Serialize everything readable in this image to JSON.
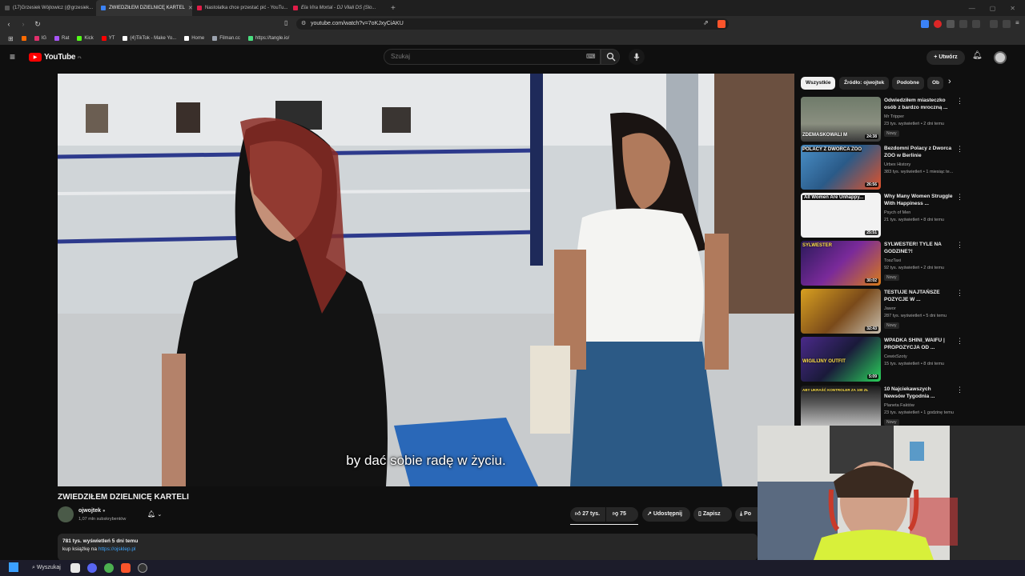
{
  "browser": {
    "tabs": [
      {
        "label": "(17)Grzesiek Wójtowicz (@grzesiek...",
        "favicon_color": "#555"
      },
      {
        "label": "ZWIEDZIŁEM DZIELNICĘ KARTEL",
        "favicon_color": "#3b82f6",
        "active": true
      },
      {
        "label": "Nastolatka chce przestać pić - YouTu...",
        "favicon_color": "#e11d48"
      },
      {
        "label": "Ela Vira Mortal - DJ Vilali DS (Slo...",
        "favicon_color": "#e11d48"
      }
    ],
    "url": "youtube.com/watch?v=7oKJxyCiAKU",
    "bookmarks": [
      {
        "label": "IG",
        "color": "#e1306c"
      },
      {
        "label": "Rat",
        "color": "#a855f7"
      },
      {
        "label": "Kick",
        "color": "#53fc18"
      },
      {
        "label": "YT",
        "color": "#ff0000"
      },
      {
        "label": "(4)TikTok - Make Yo...",
        "color": "#ffffff"
      },
      {
        "label": "Home",
        "color": "#ffffff"
      },
      {
        "label": "Filman.cc",
        "color": "#9ca3af"
      },
      {
        "label": "https://tangle.io/",
        "color": "#4ade80"
      }
    ]
  },
  "youtube": {
    "logo_text": "YouTube",
    "logo_country": "PL",
    "search_placeholder": "Szukaj",
    "create_label": "Utwórz",
    "video": {
      "caption": "by dać sobie radę w życiu.",
      "title": "ZWIEDZIŁEM DZIELNICĘ KARTELI",
      "channel": "ojwojtek",
      "subscribers": "1,07 mln subskrybentów",
      "likes": "27 tys.",
      "dislikes": "75",
      "share_label": "Udostępnij",
      "save_label": "Zapisz",
      "download_label": "Po"
    },
    "description": {
      "meta": "781 tys. wyświetleń  5 dni temu",
      "line1_prefix": "kup książkę na ",
      "line1_link": "https://ojsklep.pl"
    },
    "chips": [
      "Wszystkie",
      "Źródło: ojwojtek",
      "Podobne",
      "Ob"
    ],
    "recommendations": [
      {
        "title": "Odwiedziłem miasteczko osób z bardzo mroczną ...",
        "channel": "Mr Tripper",
        "meta": "23 tys. wyświetleń • 2 dni temu",
        "badge": "Nowy",
        "overlay": "ZDEMASKOWALI M",
        "duration": "24:38"
      },
      {
        "title": "Bezdomni Polacy z Dworca ZOO w Berlinie",
        "channel": "Urbex History",
        "meta": "383 tys. wyświetleń • 1 miesiąc te...",
        "badge": "",
        "overlay": "POLACY Z DWORCA ZOO",
        "duration": "26:56"
      },
      {
        "title": "Why Many Women Struggle With Happiness ...",
        "channel": "Psych of Men",
        "meta": "21 tys. wyświetleń • 8 dni temu",
        "badge": "",
        "overlay": "All Women Are Unhappy...",
        "duration": "25:51"
      },
      {
        "title": "SYLWESTER! TYLE NA GODZINE?!",
        "channel": "ToszTaxi",
        "meta": "92 tys. wyświetleń • 2 dni temu",
        "badge": "Nowy",
        "overlay": "SYLWESTER",
        "duration": "30:02"
      },
      {
        "title": "TESTUJE NAJTAŃSZE POZYCJE W ...",
        "channel": "Jawor",
        "meta": "287 tys. wyświetleń • 5 dni temu",
        "badge": "Nowy",
        "overlay": "",
        "duration": "32:43"
      },
      {
        "title": "WPADKA SHINI_WAIFU | PROPOZYCJA OD ...",
        "channel": "CewixSzoty",
        "meta": "15 tys. wyświetleń • 8 dni temu",
        "badge": "",
        "overlay": "WIGILIJNY OUTFIT",
        "duration": "5:09"
      },
      {
        "title": "10 Najciekawszych Newsów Tygodnia ...",
        "channel": "Planeta Faktów",
        "meta": "23 tys. wyświetleń • 1 godzinę temu",
        "badge": "Nowy",
        "overlay": "ABY UKRAŚĆ KONTROLER ZA 100 ZŁ",
        "duration": ""
      }
    ]
  },
  "taskbar": {
    "search_label": "Wyszukaj"
  }
}
